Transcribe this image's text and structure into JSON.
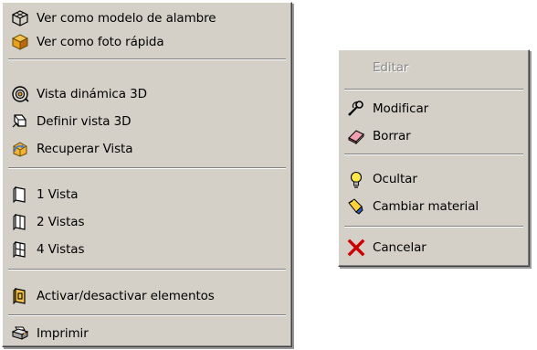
{
  "left_menu": {
    "items": [
      {
        "label": "Ver como modelo de alambre",
        "icon": "wireframe-cube-icon"
      },
      {
        "label": "Ver como foto rápida",
        "icon": "shaded-cube-icon"
      },
      {
        "label": "Vista dinámica 3D",
        "icon": "orbit-3d-icon"
      },
      {
        "label": "Definir vista 3D",
        "icon": "camera-define-icon"
      },
      {
        "label": "Recuperar Vista",
        "icon": "recover-view-icon"
      },
      {
        "label": "1 Vista",
        "icon": "single-view-icon"
      },
      {
        "label": "2 Vistas",
        "icon": "two-views-icon"
      },
      {
        "label": "4 Vistas",
        "icon": "four-views-icon"
      },
      {
        "label": "Activar/desactivar elementos",
        "icon": "toggle-elements-icon"
      },
      {
        "label": "Imprimir",
        "icon": "printer-icon"
      }
    ]
  },
  "right_menu": {
    "items": [
      {
        "label": "Editar",
        "disabled": true
      },
      {
        "label": "Modificar",
        "icon": "modify-tool-icon"
      },
      {
        "label": "Borrar",
        "icon": "eraser-icon"
      },
      {
        "label": "Ocultar",
        "icon": "lightbulb-icon"
      },
      {
        "label": "Cambiar material",
        "icon": "paint-bucket-icon"
      },
      {
        "label": "Cancelar",
        "icon": "red-x-icon"
      }
    ]
  },
  "colors": {
    "menu_bg": "#d4d0c8",
    "cancel_x": "#cc0000",
    "disabled_text": "#8a8a8a"
  }
}
